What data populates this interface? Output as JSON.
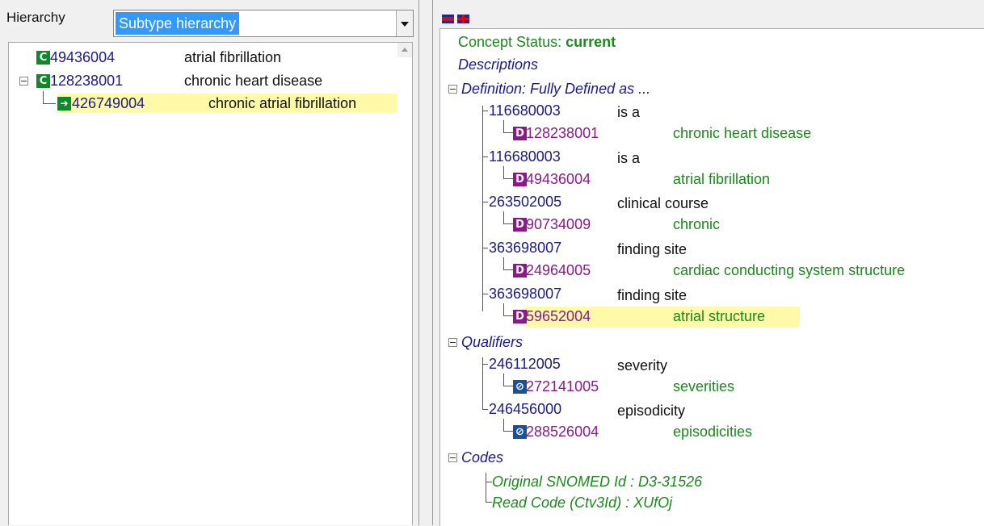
{
  "left": {
    "label": "Hierarchy",
    "select_value": "Subtype hierarchy",
    "tree": [
      {
        "code": "49436004",
        "term": "atrial fibrillation"
      },
      {
        "code": "128238001",
        "term": "chronic heart disease"
      },
      {
        "code": "426749004",
        "term": "chronic atrial fibrillation"
      }
    ]
  },
  "right": {
    "status_label": "Concept Status: ",
    "status_value": "current",
    "descriptions": "Descriptions",
    "definition": "Definition: Fully Defined as ...",
    "relationships": [
      {
        "attr_code": "116680003",
        "attr_name": "is a",
        "val_code": "128238001",
        "val_term": "chronic heart disease"
      },
      {
        "attr_code": "116680003",
        "attr_name": "is a",
        "val_code": "49436004",
        "val_term": "atrial fibrillation"
      },
      {
        "attr_code": "263502005",
        "attr_name": "clinical course",
        "val_code": "90734009",
        "val_term": "chronic"
      },
      {
        "attr_code": "363698007",
        "attr_name": "finding site",
        "val_code": "24964005",
        "val_term": "cardiac conducting system structure"
      },
      {
        "attr_code": "363698007",
        "attr_name": "finding site",
        "val_code": "59652004",
        "val_term": "atrial structure"
      }
    ],
    "qualifiers_label": "Qualifiers",
    "qualifiers": [
      {
        "attr_code": "246112005",
        "attr_name": "severity",
        "val_code": "272141005",
        "val_term": "severities"
      },
      {
        "attr_code": "246456000",
        "attr_name": "episodicity",
        "val_code": "288526004",
        "val_term": "episodicities"
      }
    ],
    "codes_label": "Codes",
    "codes": [
      "Original SNOMED Id : D3-31526",
      "Read Code (Ctv3Id) : XUfOj"
    ]
  },
  "colors": {
    "accent": "#1a8a1a",
    "concept_blue": "#1a1a8c",
    "value_purple": "#8a1a8a",
    "highlight": "#fffaa8"
  }
}
